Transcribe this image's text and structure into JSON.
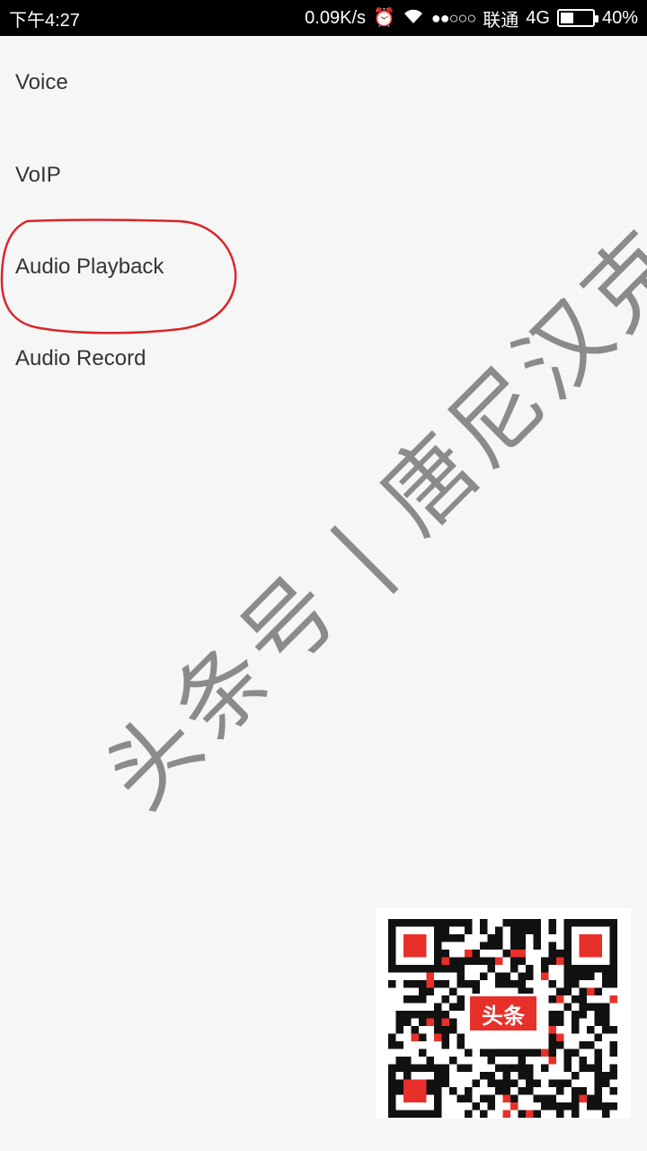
{
  "status_bar": {
    "time": "下午4:27",
    "net_speed": "0.09K/s",
    "carrier": "联通",
    "network_type": "4G",
    "battery_percent": 0.4,
    "battery_label": "40%"
  },
  "options": [
    {
      "label": "Voice"
    },
    {
      "label": "VoIP"
    },
    {
      "label": "Audio Playback"
    },
    {
      "label": "Audio Record"
    }
  ],
  "watermark": "头条号 | 唐尼汉克",
  "qr_logo_text": "头条",
  "colors": {
    "highlight": "#d9262a",
    "logo": "#e8302a"
  }
}
